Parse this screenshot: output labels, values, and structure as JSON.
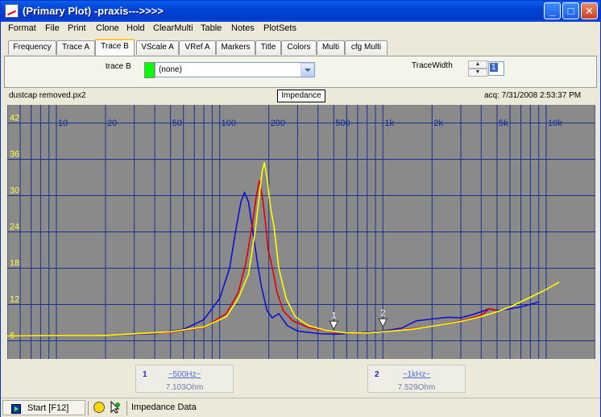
{
  "window": {
    "title": "(Primary Plot) -praxis--->>>>",
    "min_glyph": "_",
    "max_glyph": "□",
    "close_glyph": "✕"
  },
  "menu": [
    "Format",
    "File",
    "Print",
    "Clone",
    "Hold",
    "ClearMulti",
    "Table",
    "Notes",
    "PlotSets"
  ],
  "tabs": [
    "Frequency",
    "Trace A",
    "Trace B",
    "VScale A",
    "VRef A",
    "Markers",
    "Title",
    "Colors",
    "Multi",
    "cfg Multi"
  ],
  "active_tab": "Trace B",
  "trace_panel": {
    "trace_label": "trace B",
    "trace_color": "#00FF00",
    "trace_value": "(none)",
    "width_label": "TraceWidth",
    "width_value": "1",
    "spin_up": "▲",
    "spin_down": "▼"
  },
  "plot_header": {
    "filename": "dustcap removed.px2",
    "title": "Impedance",
    "acq": "acq: 7/31/2008 2:53:37 PM"
  },
  "chart_data": {
    "type": "line",
    "x_scale": "log",
    "xlim": [
      5,
      20000
    ],
    "ylim": [
      3,
      45
    ],
    "x_ticks": [
      10,
      20,
      50,
      100,
      200,
      500,
      1000,
      2000,
      5000,
      10000
    ],
    "x_tick_labels": [
      "10",
      "20",
      "50",
      "100",
      "200",
      "500",
      "1k",
      "2k",
      "5k",
      "10k"
    ],
    "y_ticks": [
      6,
      12,
      18,
      24,
      30,
      36,
      42
    ],
    "y_tick_labels": [
      "6",
      "12",
      "18",
      "24",
      "30",
      "36",
      "42"
    ],
    "grid": true,
    "series": [
      {
        "color": "#1010D0",
        "points": [
          [
            5,
            6.8
          ],
          [
            10,
            6.8
          ],
          [
            20,
            6.9
          ],
          [
            40,
            7.2
          ],
          [
            60,
            7.9
          ],
          [
            80,
            9.5
          ],
          [
            100,
            13
          ],
          [
            115,
            18
          ],
          [
            125,
            24
          ],
          [
            135,
            29
          ],
          [
            142,
            30.5
          ],
          [
            150,
            29
          ],
          [
            160,
            24
          ],
          [
            170,
            19
          ],
          [
            180,
            15
          ],
          [
            195,
            11
          ],
          [
            210,
            9.8
          ],
          [
            230,
            10.5
          ],
          [
            260,
            8.5
          ],
          [
            300,
            7.6
          ],
          [
            400,
            7.2
          ],
          [
            500,
            7.1
          ],
          [
            700,
            7.3
          ],
          [
            1000,
            7.6
          ],
          [
            1300,
            8.1
          ],
          [
            1600,
            9.3
          ],
          [
            2000,
            9.6
          ],
          [
            2500,
            9.9
          ],
          [
            3000,
            9.8
          ],
          [
            3500,
            10.3
          ],
          [
            4000,
            10.8
          ],
          [
            4500,
            11.3
          ],
          [
            5000,
            11.0
          ],
          [
            6000,
            11.3
          ],
          [
            7000,
            11.6
          ],
          [
            9000,
            12.4
          ]
        ]
      },
      {
        "color": "#E00000",
        "points": [
          [
            5,
            6.8
          ],
          [
            20,
            6.9
          ],
          [
            50,
            7.4
          ],
          [
            80,
            8.2
          ],
          [
            110,
            10.5
          ],
          [
            130,
            14
          ],
          [
            145,
            19
          ],
          [
            158,
            25
          ],
          [
            168,
            30
          ],
          [
            175,
            32.5
          ],
          [
            182,
            30
          ],
          [
            190,
            26
          ],
          [
            198,
            21
          ],
          [
            205,
            19.5
          ],
          [
            212,
            17.5
          ],
          [
            225,
            14
          ],
          [
            245,
            11
          ],
          [
            280,
            9.3
          ],
          [
            350,
            8.2
          ],
          [
            500,
            7.4
          ],
          [
            700,
            7.2
          ],
          [
            1000,
            7.5
          ],
          [
            1500,
            8.0
          ],
          [
            2000,
            8.4
          ],
          [
            3000,
            9.3
          ],
          [
            4000,
            10.2
          ],
          [
            4500,
            11.3
          ],
          [
            5000,
            11.0
          ]
        ]
      },
      {
        "color": "#FFFF00",
        "points": [
          [
            5,
            6.8
          ],
          [
            20,
            6.9
          ],
          [
            50,
            7.5
          ],
          [
            80,
            8.3
          ],
          [
            110,
            10
          ],
          [
            130,
            13
          ],
          [
            150,
            17
          ],
          [
            165,
            24
          ],
          [
            175,
            30
          ],
          [
            182,
            34
          ],
          [
            188,
            35.5
          ],
          [
            195,
            33
          ],
          [
            205,
            28
          ],
          [
            215,
            25
          ],
          [
            230,
            18
          ],
          [
            255,
            13
          ],
          [
            290,
            10
          ],
          [
            350,
            8.5
          ],
          [
            450,
            7.7
          ],
          [
            600,
            7.3
          ],
          [
            800,
            7.3
          ],
          [
            1000,
            7.5
          ],
          [
            1500,
            7.9
          ],
          [
            2000,
            8.4
          ],
          [
            3000,
            9.2
          ],
          [
            4000,
            10.0
          ],
          [
            5000,
            10.8
          ],
          [
            6000,
            11.6
          ],
          [
            8000,
            13.2
          ],
          [
            10000,
            14.5
          ],
          [
            12000,
            15.7
          ]
        ]
      }
    ],
    "markers": [
      {
        "label": "1",
        "x": 500,
        "y": 7.1
      },
      {
        "label": "2",
        "x": 1000,
        "y": 7.5
      }
    ]
  },
  "marker_readouts": [
    {
      "num": "1",
      "freq": "~500Hz~",
      "value": "7.103Ohm"
    },
    {
      "num": "2",
      "freq": "~1kHz~",
      "value": "7.529Ohm"
    }
  ],
  "status": {
    "start_label": "Start [F12]",
    "text": "Impedance Data"
  }
}
